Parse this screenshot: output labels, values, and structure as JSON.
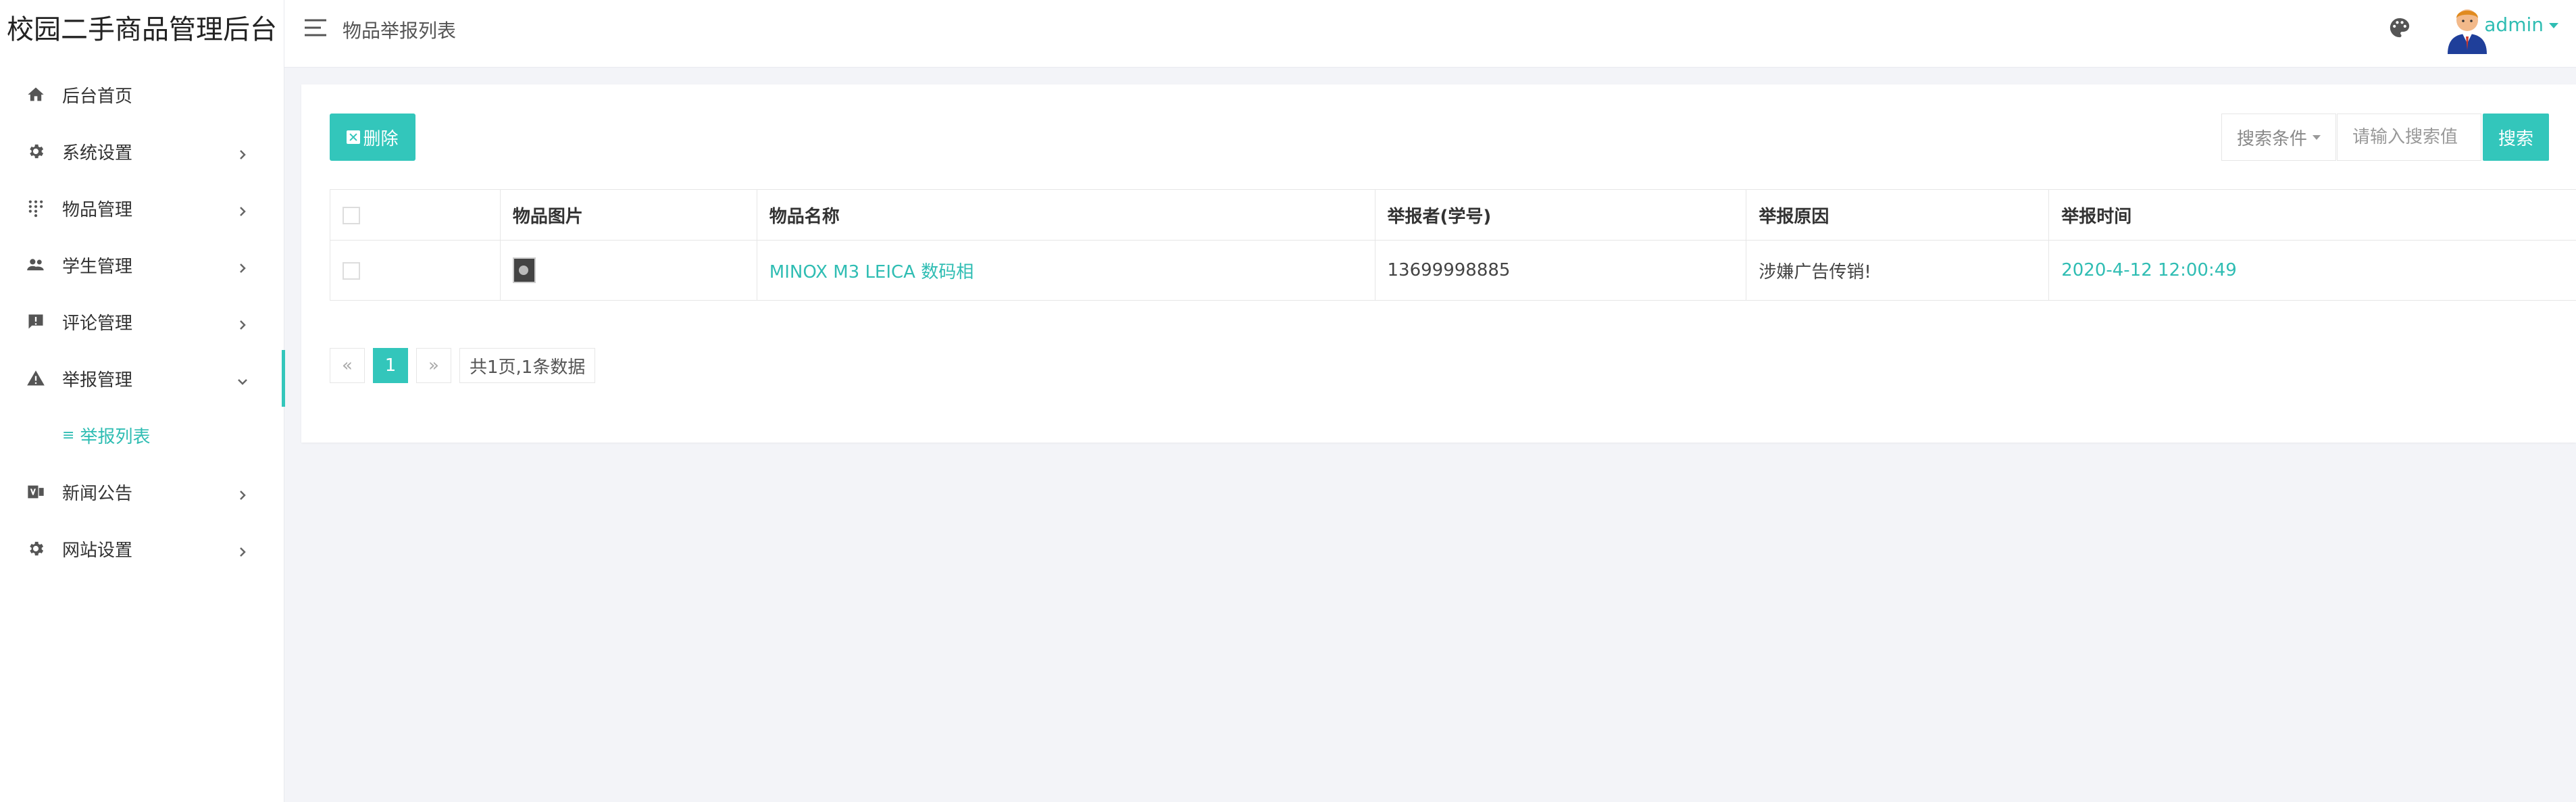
{
  "brand": {
    "title": "校园二手商品管理后台"
  },
  "sidebar": {
    "items": [
      {
        "label": "后台首页",
        "icon": "home-icon"
      },
      {
        "label": "系统设置",
        "icon": "gear-icon"
      },
      {
        "label": "物品管理",
        "icon": "grid-dots-icon"
      },
      {
        "label": "学生管理",
        "icon": "users-icon"
      },
      {
        "label": "评论管理",
        "icon": "comment-alert-icon"
      },
      {
        "label": "举报管理",
        "icon": "warning-icon",
        "expanded": true
      },
      {
        "label": "新闻公告",
        "icon": "news-icon"
      },
      {
        "label": "网站设置",
        "icon": "gear-icon"
      }
    ],
    "subitem": {
      "label": "举报列表",
      "prefix": "≡"
    }
  },
  "header": {
    "breadcrumb": "物品举报列表",
    "username": "admin"
  },
  "toolbar": {
    "delete_label": "删除",
    "search_condition_label": "搜索条件",
    "search_placeholder": "请输入搜索值",
    "search_label": "搜索"
  },
  "table": {
    "columns": [
      "物品图片",
      "物品名称",
      "举报者(学号)",
      "举报原因",
      "举报时间"
    ],
    "rows": [
      {
        "item_name": "MINOX M3 LEICA 数码相",
        "reporter": "13699998885",
        "reason": "涉嫌广告传销!",
        "time": "2020-4-12 12:00:49"
      }
    ]
  },
  "pagination": {
    "prev": "«",
    "current": "1",
    "next": "»",
    "summary": "共1页,1条数据"
  },
  "colors": {
    "accent": "#33c6bb"
  }
}
